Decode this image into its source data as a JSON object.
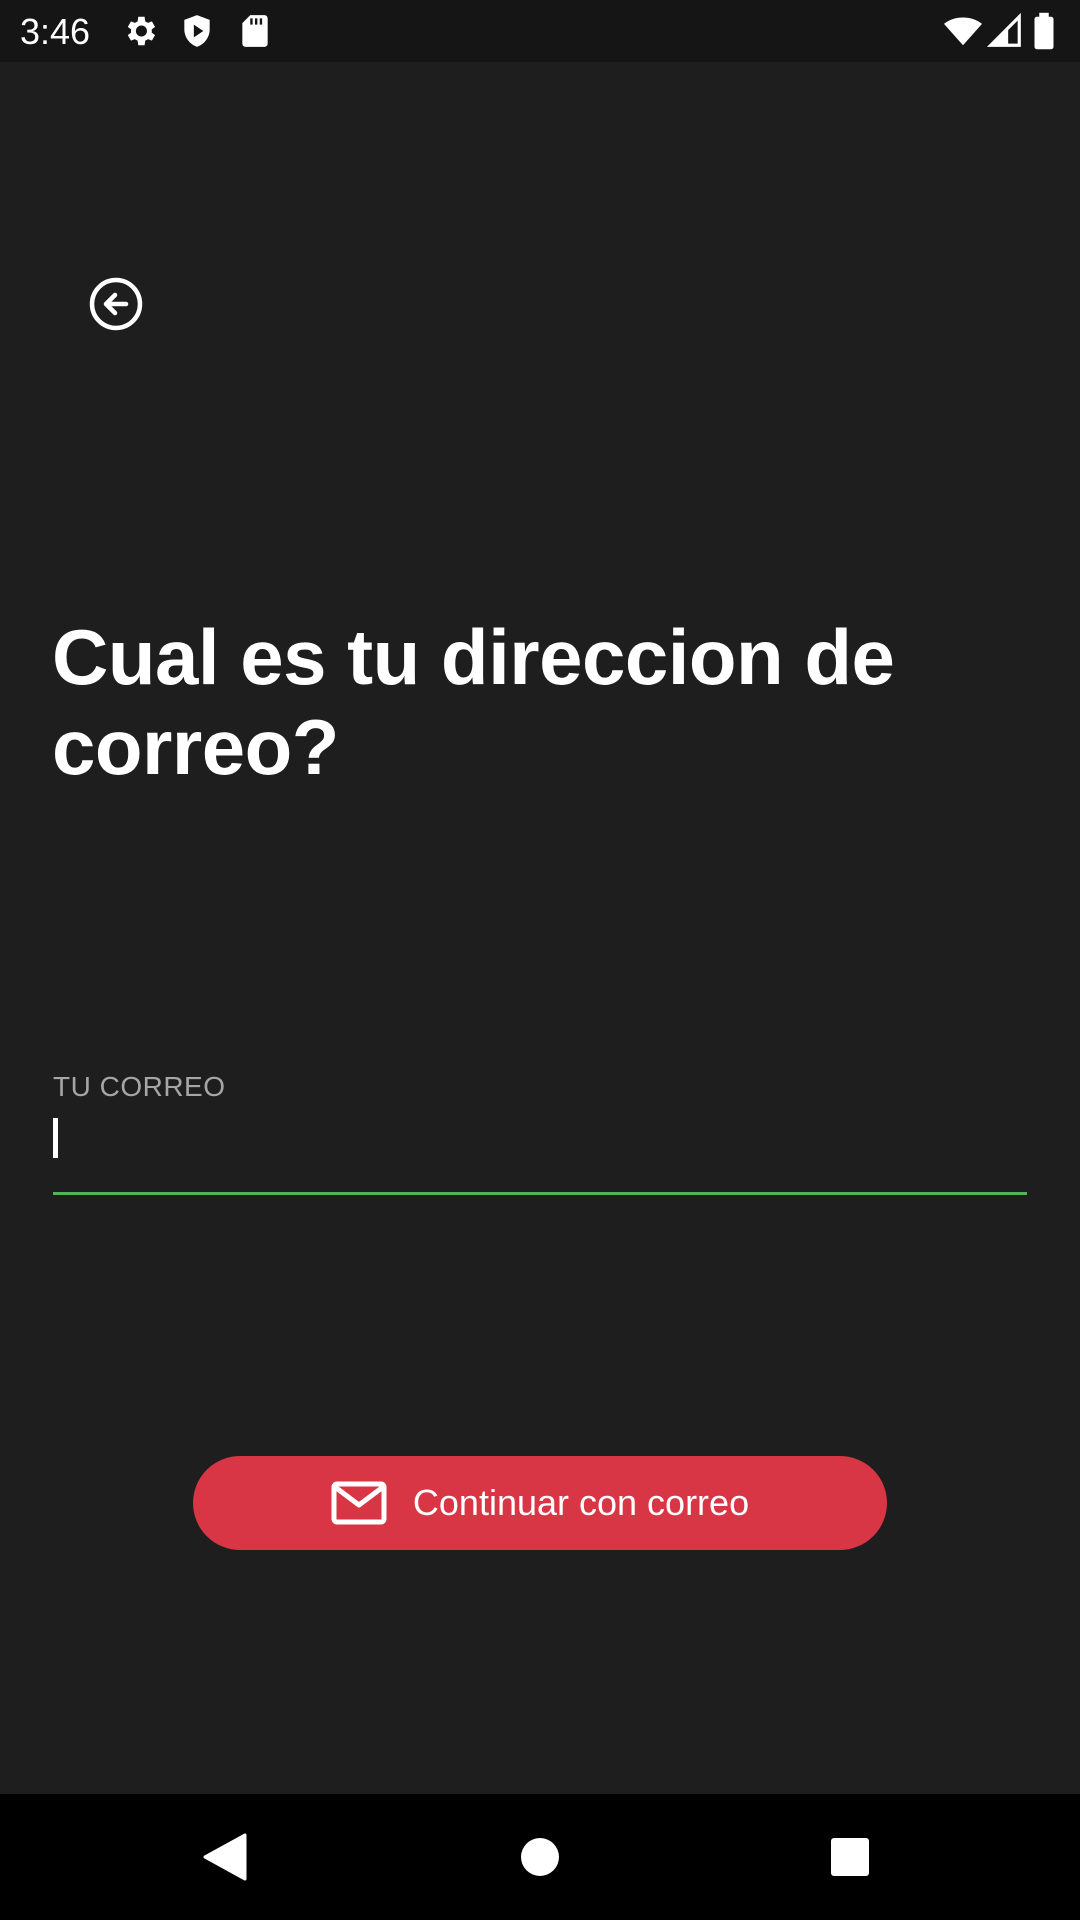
{
  "status_bar": {
    "time": "3:46",
    "icons": [
      "gear-icon",
      "shield-play-icon",
      "sd-card-icon",
      "wifi-icon",
      "signal-icon",
      "battery-icon"
    ]
  },
  "header": {
    "back_icon": "arrow-left-circle-icon"
  },
  "main": {
    "title": "Cual es tu direccion de correo?",
    "email_field": {
      "label": "TU CORREO",
      "value": "",
      "underline_color": "#57b05a"
    },
    "continue_button": {
      "label": "Continuar con correo",
      "icon": "mail-icon",
      "color": "#d83545"
    }
  },
  "nav_bar": {
    "buttons": [
      "back-triangle-icon",
      "home-circle-icon",
      "recents-square-icon"
    ]
  },
  "colors": {
    "background": "#1e1e1e",
    "status_bar": "#151515",
    "nav_bar": "#000000",
    "text": "#ffffff",
    "label": "#a6a6a6"
  }
}
